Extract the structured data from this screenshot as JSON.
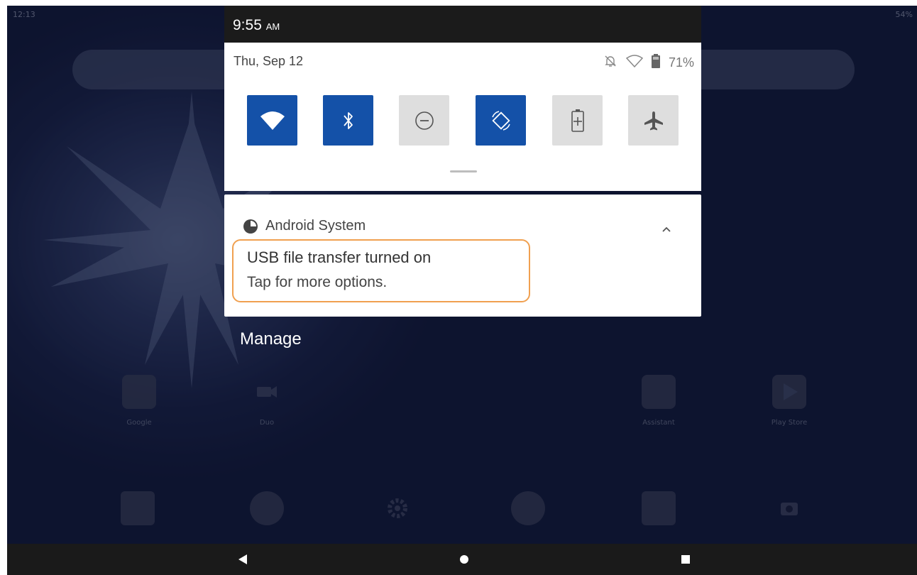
{
  "home": {
    "status_time": "12:13",
    "status_battery": "54%",
    "apps": [
      {
        "label": "Google"
      },
      {
        "label": "Duo"
      },
      {
        "label": "Assistant"
      },
      {
        "label": "Play Store"
      }
    ]
  },
  "shade": {
    "time": "9:55",
    "ampm": "AM",
    "date": "Thu, Sep 12",
    "battery_text": "71%",
    "tiles": [
      {
        "name": "wifi-icon",
        "state": "on"
      },
      {
        "name": "bluetooth-icon",
        "state": "on"
      },
      {
        "name": "do-not-disturb-icon",
        "state": "off"
      },
      {
        "name": "auto-rotate-icon",
        "state": "on"
      },
      {
        "name": "battery-saver-icon",
        "state": "off"
      },
      {
        "name": "airplane-mode-icon",
        "state": "off"
      }
    ]
  },
  "notification": {
    "app_name": "Android System",
    "title": "USB file transfer turned on",
    "body": "Tap for more options."
  },
  "manage_label": "Manage",
  "colors": {
    "tile_on": "#1451a8",
    "tile_off": "#dedede",
    "highlight": "#f0a050"
  }
}
